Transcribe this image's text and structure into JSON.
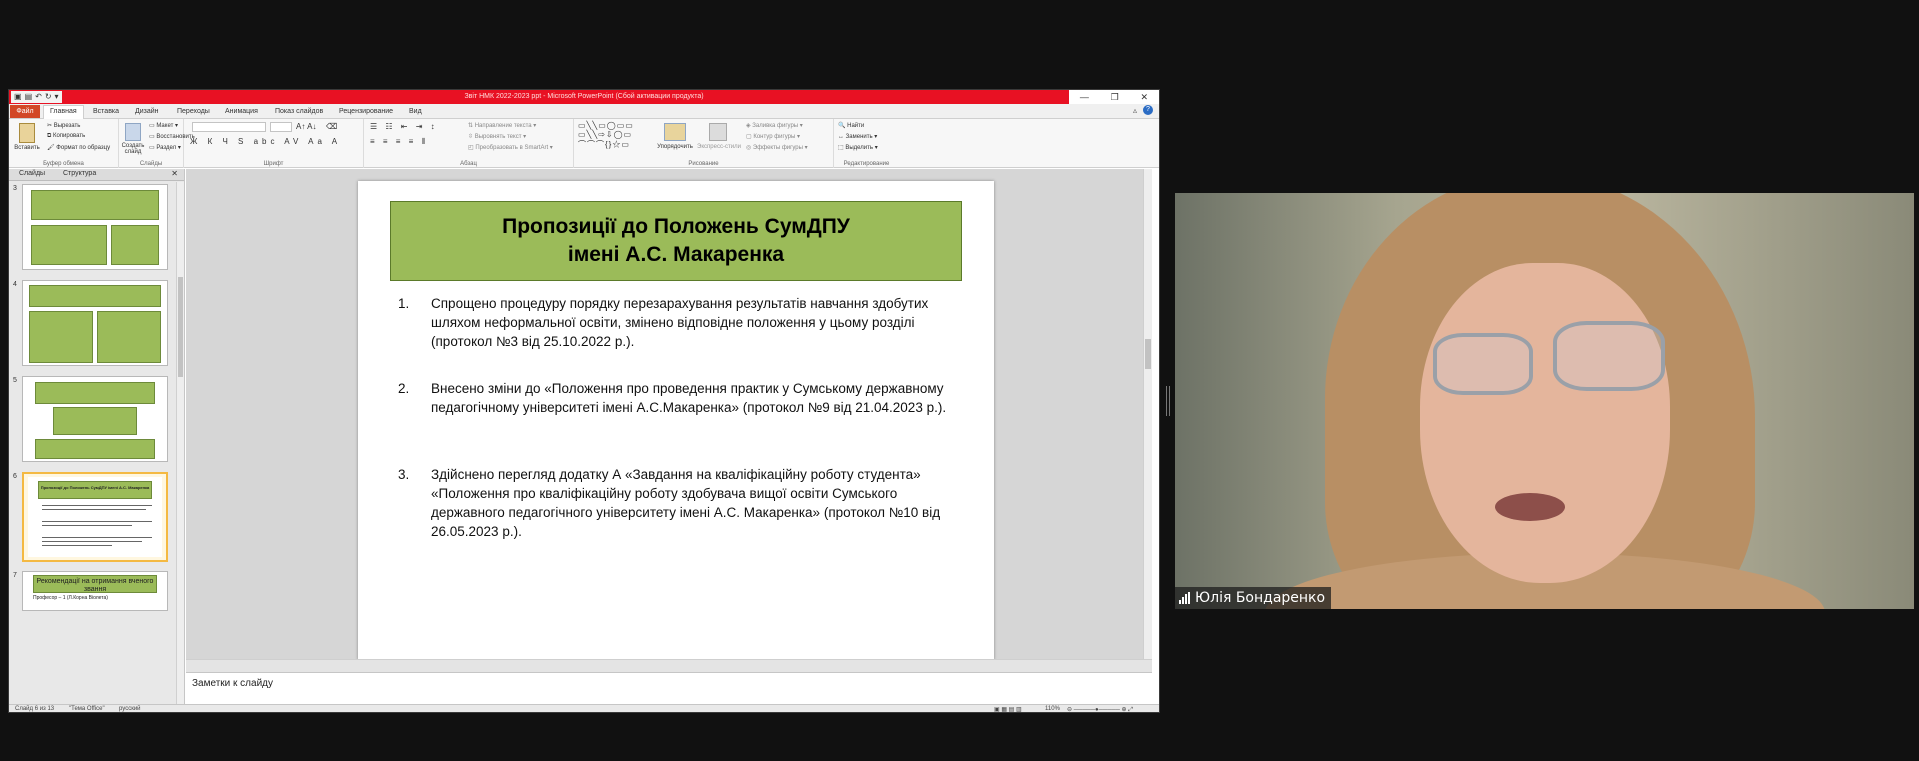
{
  "app": {
    "window_title": "Звіт НМК 2022-2023 ppt - Microsoft PowerPoint (Сбой активации продукта)",
    "file_tab": "Файл",
    "tabs": [
      "Главная",
      "Вставка",
      "Дизайн",
      "Переходы",
      "Анимация",
      "Показ слайдов",
      "Рецензирование",
      "Вид"
    ]
  },
  "ribbon": {
    "clipboard": {
      "paste": "Вставить",
      "cut": "Вырезать",
      "copy": "Копировать",
      "format": "Формат по образцу",
      "label": "Буфер обмена"
    },
    "slides": {
      "new_slide": "Создать слайд",
      "layout": "Макет",
      "reset": "Восстановить",
      "section": "Раздел",
      "label": "Слайды"
    },
    "font": {
      "label": "Шрифт"
    },
    "paragraph": {
      "direction": "Направление текста",
      "align": "Выровнять текст",
      "smartart": "Преобразовать в SmartArt",
      "label": "Абзац"
    },
    "drawing": {
      "arrange": "Упорядочить",
      "styles": "Экспресс-стили",
      "fill": "Заливка фигуры",
      "outline": "Контур фигуры",
      "effects": "Эффекты фигуры",
      "label": "Рисование"
    },
    "editing": {
      "find": "Найти",
      "replace": "Заменить",
      "select": "Выделить",
      "label": "Редактирование"
    }
  },
  "left_pane": {
    "tabs": [
      "Слайды",
      "Структура"
    ],
    "thumb_numbers": [
      "3",
      "4",
      "5",
      "6",
      "7"
    ],
    "thumb6": {
      "title": "Пропозиції до Положень СумДПУ імені А.С. Макаренка"
    },
    "thumb7": {
      "title": "Рекомендації на отримання вченого звання",
      "bullet": "Професор – 1 (Л.Корна Віолета)"
    }
  },
  "slide": {
    "title": "Пропозиції до Положень СумДПУ імені А.С. Макаренка",
    "items": [
      {
        "num": "1.",
        "text": "Спрощено процедуру порядку перезарахування  результатів  навчання  здобутих шляхом неформальної освіти, змінено відповідне положення у цьому розділі (протокол №3 від 25.10.2022 р.)."
      },
      {
        "num": "2.",
        "text": " Внесено зміни до «Положення про проведення практик у Сумському державному педагогічному університеті  імені А.С.Макаренка»  (протокол №9 від 21.04.2023 р.)."
      },
      {
        "num": "3.",
        "text": "Здійснено перегляд додатку А «Завдання  на кваліфікаційну  роботу студента» «Положення про кваліфікаційну  роботу здобувача вищої освіти Сумського державного педагогічного університету імені А.С. Макаренка» (протокол №10 від 26.05.2023  р.)."
      }
    ]
  },
  "notes": {
    "placeholder": "Заметки к слайду"
  },
  "status": {
    "slide_count": "Слайд 6 из 13",
    "theme": "\"Тема Office\"",
    "language": "русский",
    "zoom": "110%"
  },
  "video": {
    "participant_name": "Юлія Бондаренко"
  }
}
